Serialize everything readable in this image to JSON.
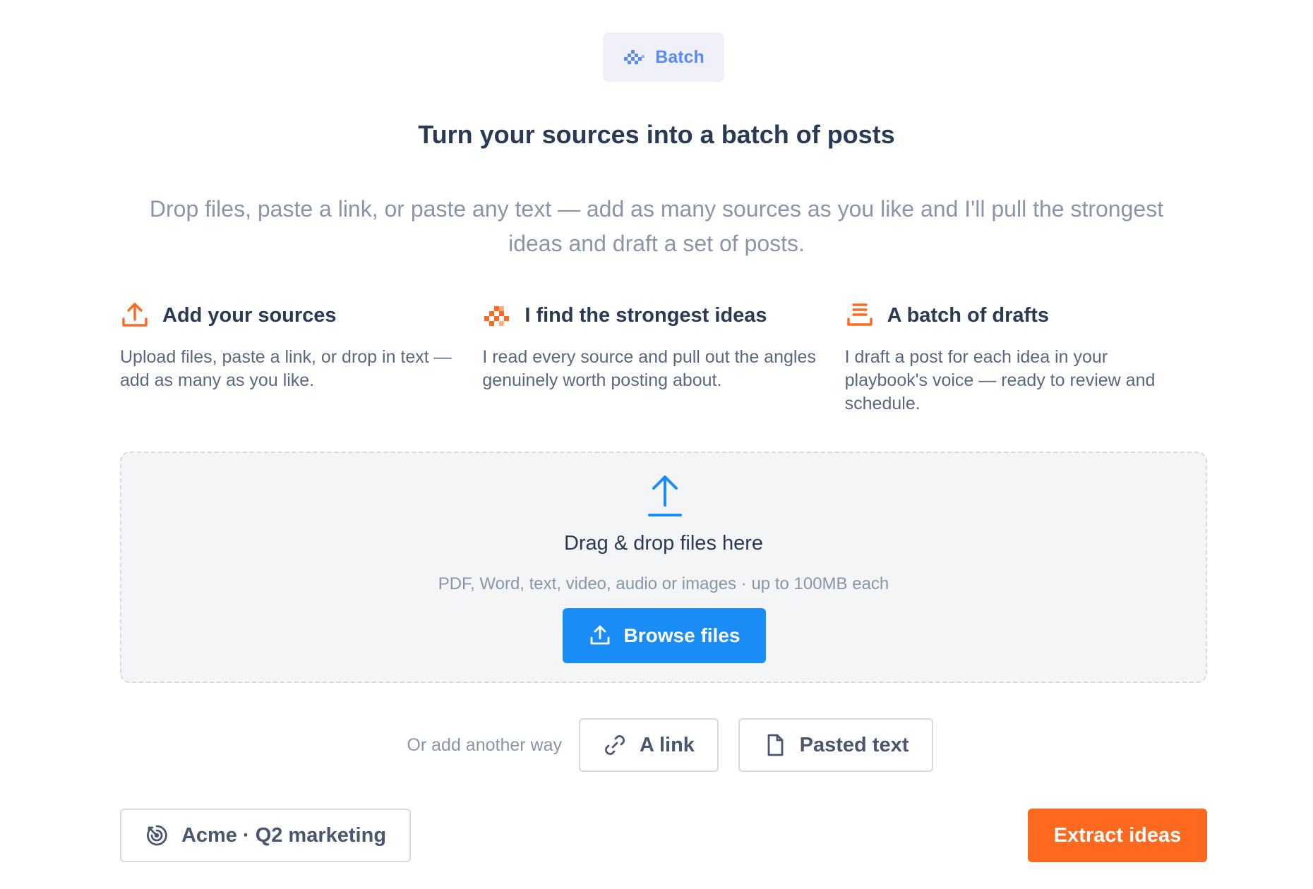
{
  "badge": {
    "label": "Batch",
    "icon": "batch-pixel-icon",
    "color": "#5b8bf0"
  },
  "header": {
    "title": "Turn your sources into a batch of posts",
    "subtitle": "Drop files, paste a link, or paste any text — add as many sources as you like and I'll pull the strongest ideas and draft a set of posts."
  },
  "steps": [
    {
      "icon": "upload-icon",
      "title": "Add your sources",
      "description": "Upload files, paste a link, or drop in text — add as many as you like."
    },
    {
      "icon": "pixel-sparkle-icon",
      "title": "I find the strongest ideas",
      "description": "I read every source and pull out the angles genuinely worth posting about."
    },
    {
      "icon": "stack-icon",
      "title": "A batch of drafts",
      "description": "I draft a post for each idea in your playbook's voice — ready to review and schedule."
    }
  ],
  "dropzone": {
    "icon": "upload-arrow-icon",
    "title": "Drag & drop files here",
    "hint": "PDF, Word, text, video, audio or images · up to 100MB each",
    "browse_label": "Browse files"
  },
  "other_ways": {
    "label": "Or add another way",
    "link_label": "A link",
    "text_label": "Pasted text"
  },
  "footer": {
    "workspace_label": "Acme · Q2 marketing",
    "extract_label": "Extract ideas"
  },
  "colors": {
    "accent_orange": "#fd6a1f",
    "accent_blue": "#1a8cf5",
    "text_dark": "#2a3a55",
    "text_muted": "#8a95a8"
  }
}
